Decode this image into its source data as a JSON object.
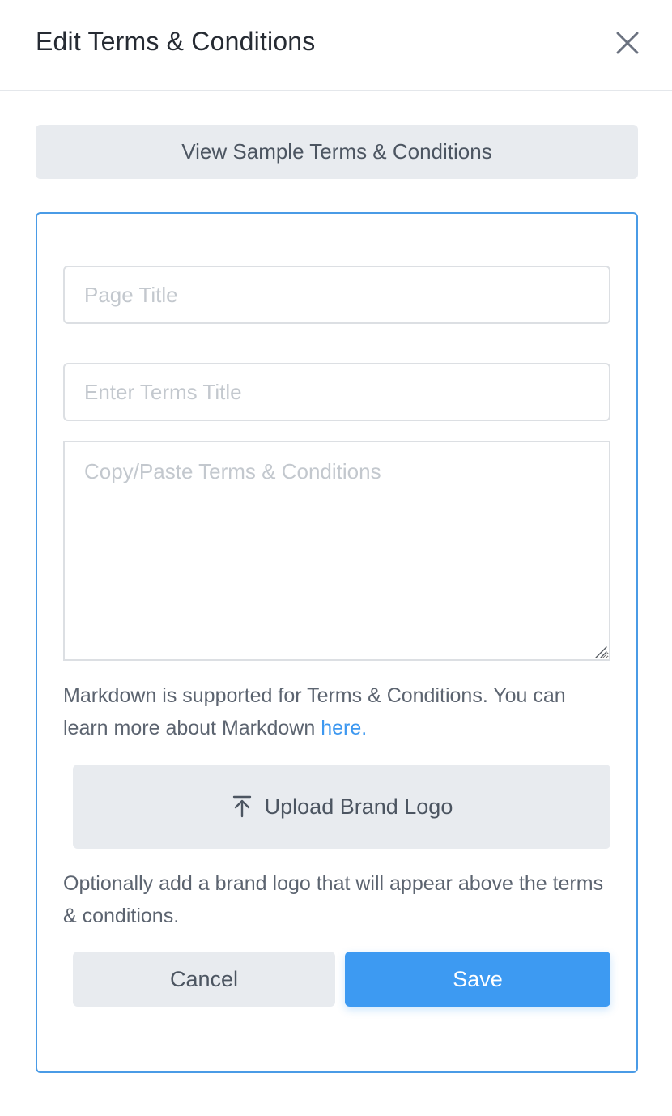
{
  "header": {
    "title": "Edit Terms & Conditions",
    "close_icon": "close-icon"
  },
  "sample_button": {
    "label": "View Sample Terms & Conditions"
  },
  "form": {
    "page_title": {
      "value": "",
      "placeholder": "Page Title"
    },
    "terms_title": {
      "value": "",
      "placeholder": "Enter Terms Title"
    },
    "terms_body": {
      "value": "",
      "placeholder": "Copy/Paste Terms & Conditions"
    },
    "markdown_note": {
      "text": "Markdown is supported for Terms & Conditions. You can learn more about Markdown ",
      "link_label": "here."
    },
    "upload": {
      "icon": "upload-icon",
      "label": "Upload Brand Logo"
    },
    "logo_note": "Optionally add a brand logo that will appear above the terms & conditions.",
    "cancel_label": "Cancel",
    "save_label": "Save"
  },
  "colors": {
    "accent": "#3d9af2",
    "panel_border": "#4a9be6",
    "secondary_button": "#e8ebef",
    "link": "#3d98f0"
  }
}
